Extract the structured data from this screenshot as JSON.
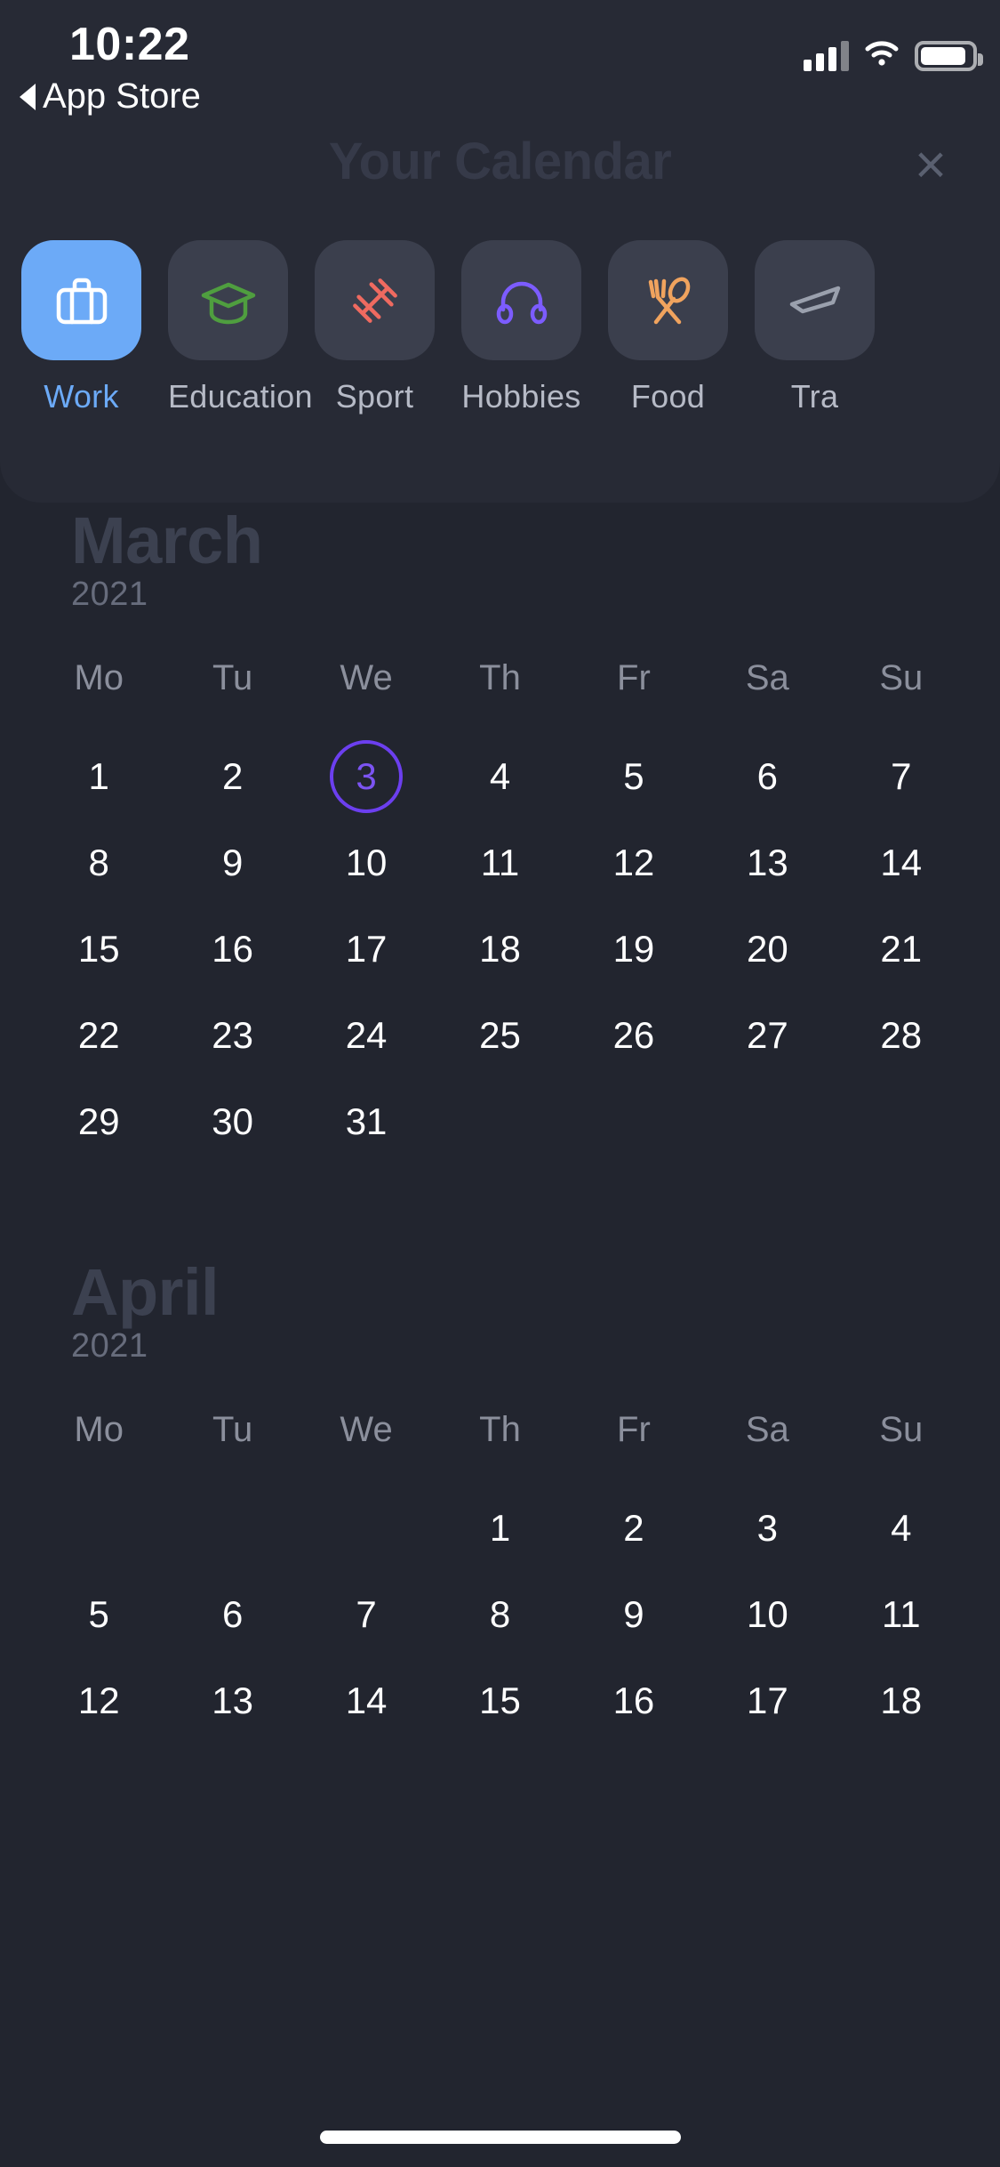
{
  "status_bar": {
    "time": "10:22",
    "back_label": "App Store",
    "icons": [
      "signal-icon",
      "wifi-icon",
      "battery-icon"
    ]
  },
  "overlay": {
    "title": "Your Calendar",
    "close_label": "×",
    "categories": [
      {
        "label": "Work",
        "icon": "briefcase-icon",
        "color": "#ffffff",
        "active": true
      },
      {
        "label": "Education",
        "icon": "graduation-cap-icon",
        "color": "#4f9e3f",
        "active": false
      },
      {
        "label": "Sport",
        "icon": "dumbbell-icon",
        "color": "#ef6a60",
        "active": false
      },
      {
        "label": "Hobbies",
        "icon": "headphones-icon",
        "color": "#7c5cff",
        "active": false
      },
      {
        "label": "Food",
        "icon": "fork-spoon-icon",
        "color": "#f0a35e",
        "active": false
      },
      {
        "label": "Tra",
        "icon": "travel-icon",
        "color": "#9aa0ad",
        "active": false
      }
    ]
  },
  "colors": {
    "background": "#22252f",
    "panel": "#272a35",
    "accent_blue": "#6caaf7",
    "accent_violet": "#6c3fef",
    "muted_heading": "#3c4150",
    "muted_text": "#676c7c"
  },
  "calendar": {
    "weekday_headers": [
      "Mo",
      "Tu",
      "We",
      "Th",
      "Fr",
      "Sa",
      "Su"
    ],
    "selected_day": 3,
    "selected_month": "March",
    "months": [
      {
        "name": "March",
        "year": "2021",
        "weeks": [
          [
            "1",
            "2",
            "3",
            "4",
            "5",
            "6",
            "7"
          ],
          [
            "8",
            "9",
            "10",
            "11",
            "12",
            "13",
            "14"
          ],
          [
            "15",
            "16",
            "17",
            "18",
            "19",
            "20",
            "21"
          ],
          [
            "22",
            "23",
            "24",
            "25",
            "26",
            "27",
            "28"
          ],
          [
            "29",
            "30",
            "31",
            "",
            "",
            "",
            ""
          ]
        ]
      },
      {
        "name": "April",
        "year": "2021",
        "weeks": [
          [
            "",
            "",
            "",
            "1",
            "2",
            "3",
            "4"
          ],
          [
            "5",
            "6",
            "7",
            "8",
            "9",
            "10",
            "11"
          ],
          [
            "12",
            "13",
            "14",
            "15",
            "16",
            "17",
            "18"
          ]
        ]
      }
    ]
  }
}
